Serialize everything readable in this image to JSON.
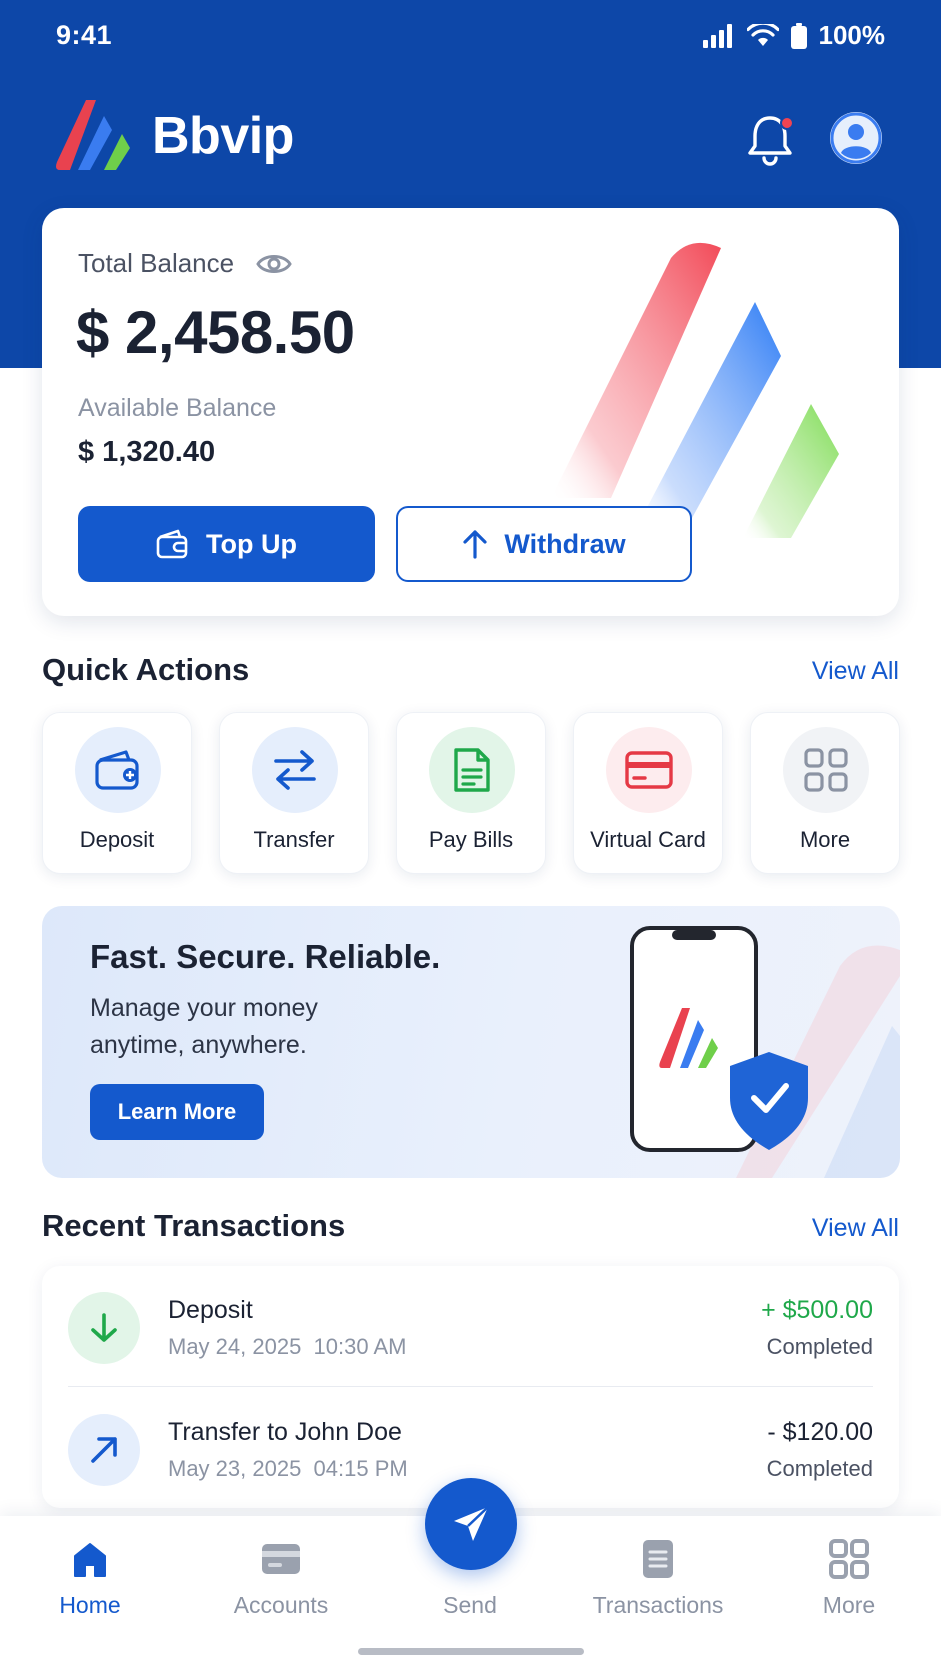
{
  "status_bar": {
    "time": "9:41",
    "battery": "100%"
  },
  "header": {
    "app_name": "Bbvip"
  },
  "balance": {
    "total_label": "Total Balance",
    "total_amount": "$ 2,458.50",
    "available_label": "Available Balance",
    "available_amount": "$ 1,320.40",
    "topup_label": "Top Up",
    "withdraw_label": "Withdraw"
  },
  "quick_actions": {
    "title": "Quick Actions",
    "view_all": "View All",
    "items": [
      {
        "label": "Deposit",
        "icon": "wallet-icon",
        "color": "#1459cd",
        "bg": "#e5eefc"
      },
      {
        "label": "Transfer",
        "icon": "transfer-icon",
        "color": "#1459cd",
        "bg": "#e5eefc"
      },
      {
        "label": "Pay Bills",
        "icon": "bill-icon",
        "color": "#1fa84a",
        "bg": "#e2f5e8"
      },
      {
        "label": "Virtual Card",
        "icon": "card-icon",
        "color": "#e53945",
        "bg": "#fdecee"
      },
      {
        "label": "More",
        "icon": "grid-icon",
        "color": "#8b93a3",
        "bg": "#f1f3f6"
      }
    ]
  },
  "promo": {
    "title": "Fast. Secure. Reliable.",
    "subtitle": "Manage your money anytime, anywhere.",
    "button": "Learn More"
  },
  "transactions": {
    "title": "Recent Transactions",
    "view_all": "View All",
    "items": [
      {
        "title": "Deposit",
        "date": "May 24, 2025  10:30 AM",
        "amount": "+ $500.00",
        "status": "Completed",
        "icon": "arrow-down-icon",
        "amount_color": "#1fa84a"
      },
      {
        "title": "Transfer to John Doe",
        "date": "May 23, 2025  04:15 PM",
        "amount": "- $120.00",
        "status": "Completed",
        "icon": "arrow-up-right-icon",
        "amount_color": "#1b2233"
      }
    ]
  },
  "bottom_nav": {
    "items": [
      {
        "label": "Home",
        "icon": "home-icon",
        "active": true
      },
      {
        "label": "Accounts",
        "icon": "accounts-icon",
        "active": false
      },
      {
        "label": "Send",
        "icon": "send-icon",
        "active": false
      },
      {
        "label": "Transactions",
        "icon": "transactions-icon",
        "active": false
      },
      {
        "label": "More",
        "icon": "grid-icon",
        "active": false
      }
    ]
  },
  "colors": {
    "primary": "#1459cd",
    "header_bg": "#0d47a8",
    "success": "#1fa84a",
    "danger": "#e53945"
  }
}
